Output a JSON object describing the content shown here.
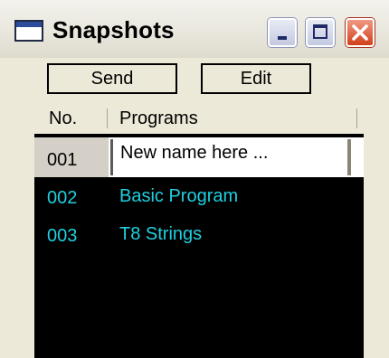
{
  "window": {
    "title": "Snapshots",
    "icon": "window-icon"
  },
  "toolbar": {
    "send_label": "Send",
    "edit_label": "Edit"
  },
  "table": {
    "columns": [
      "No.",
      "Programs"
    ],
    "rows": [
      {
        "no": "001",
        "name": "New name here ...",
        "selected": true,
        "editing": true
      },
      {
        "no": "002",
        "name": "Basic Program",
        "selected": false
      },
      {
        "no": "003",
        "name": "T8 Strings",
        "selected": false
      }
    ]
  },
  "colors": {
    "list_background": "#000000",
    "list_text": "#1fd0e0",
    "selection_cell": "#d4d0c8",
    "window_face": "#ece9d8",
    "close_button": "#d1401a"
  }
}
